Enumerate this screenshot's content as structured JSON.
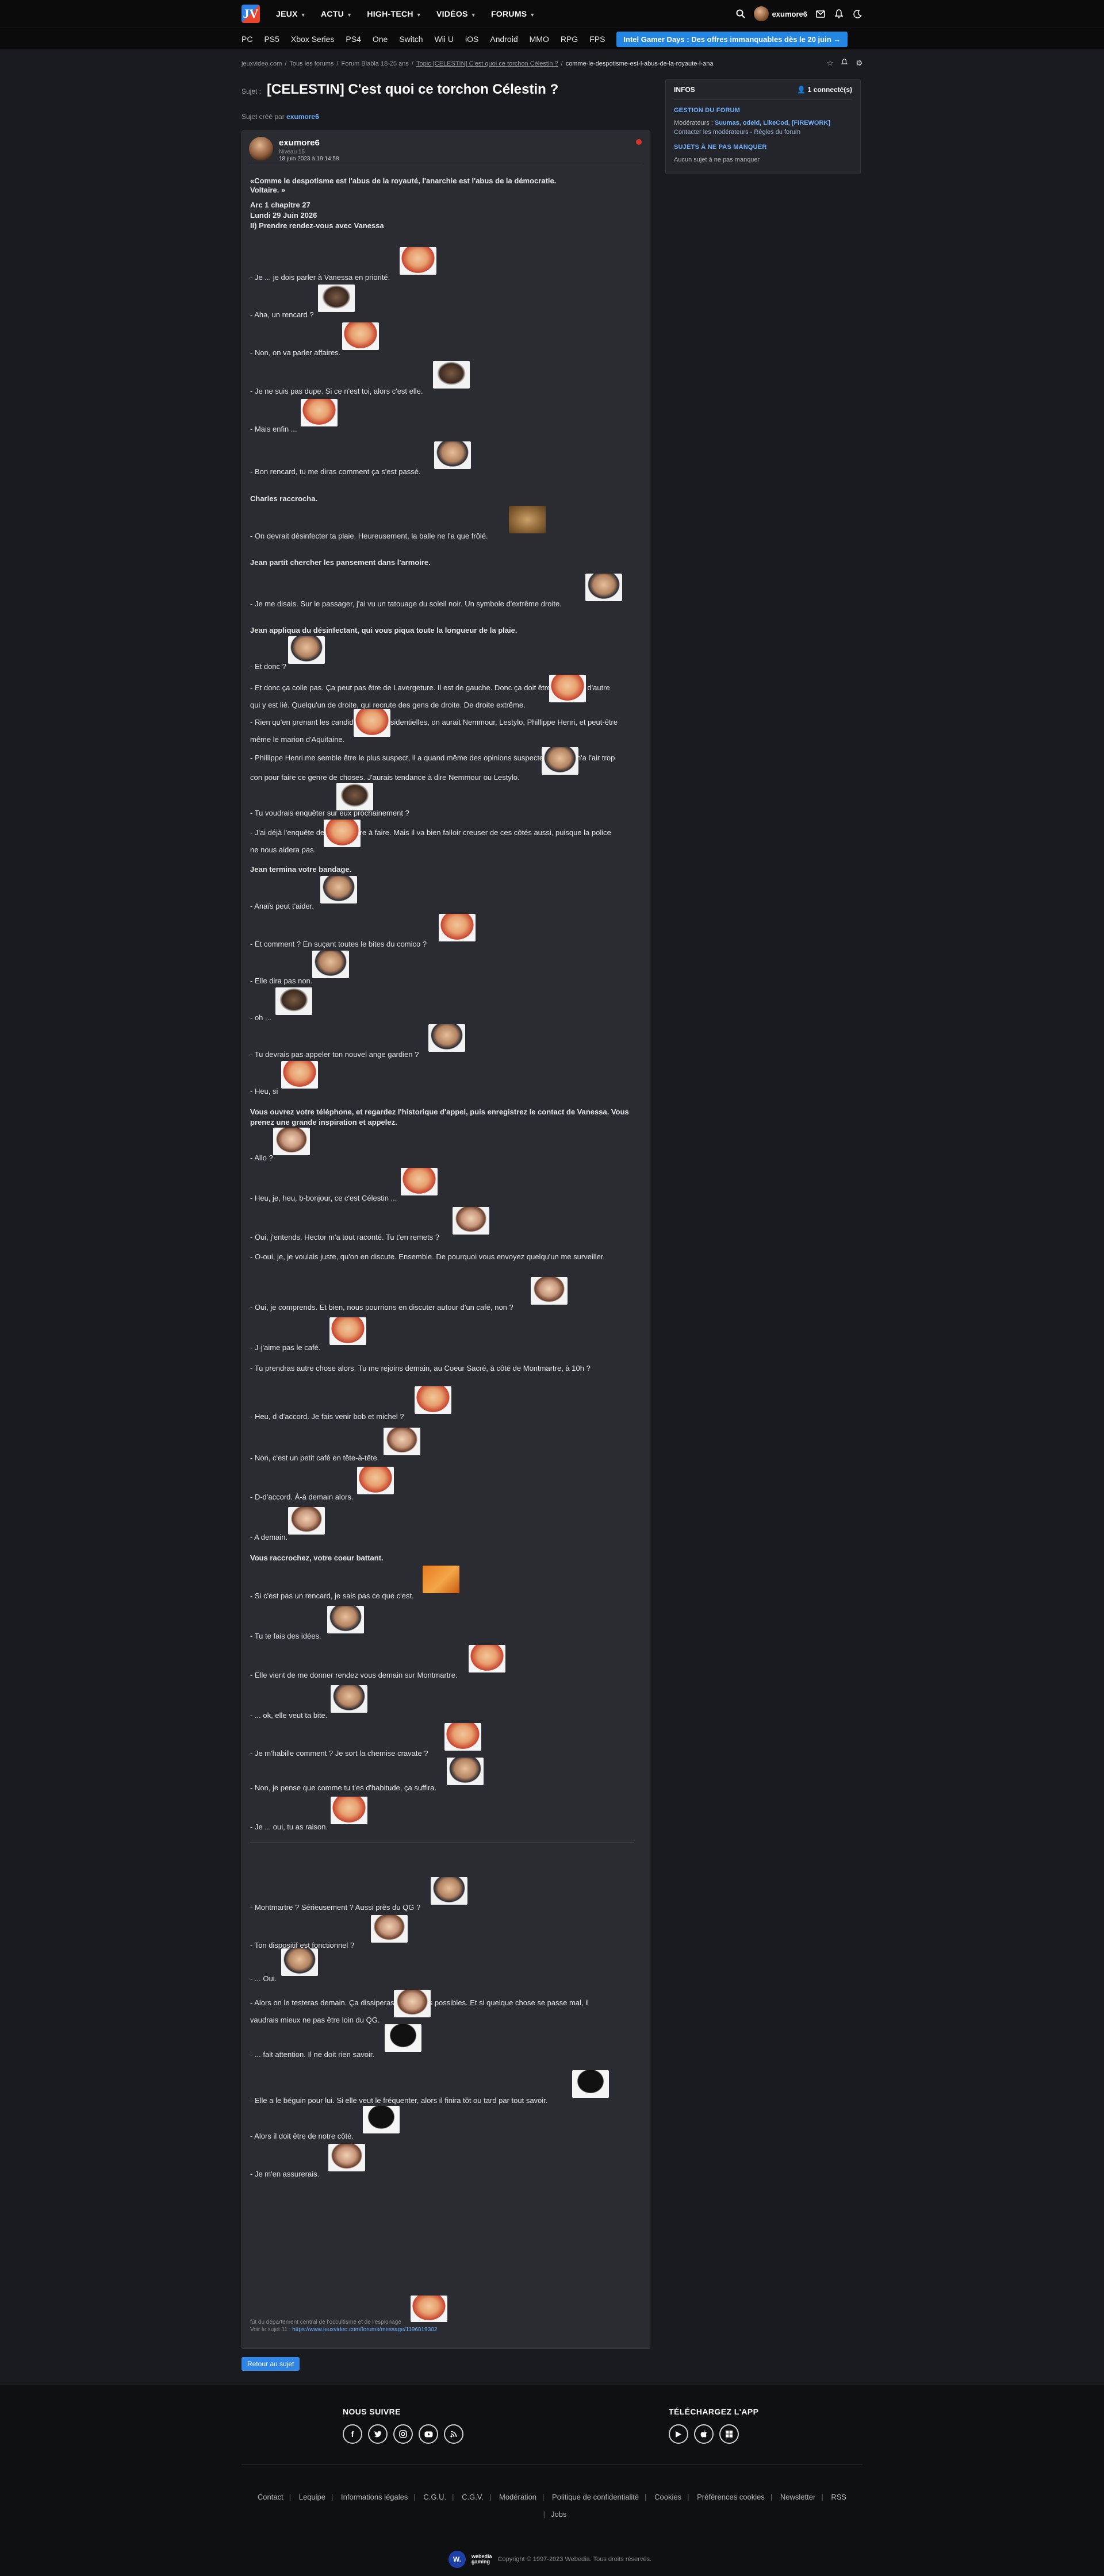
{
  "nav": {
    "logo": "JV",
    "main": [
      {
        "label": "JEUX"
      },
      {
        "label": "ACTU"
      },
      {
        "label": "HIGH-TECH"
      },
      {
        "label": "VIDÉOS"
      },
      {
        "label": "FORUMS"
      }
    ],
    "username": "exumore6",
    "platforms": [
      "PC",
      "PS5",
      "Xbox Series",
      "PS4",
      "One",
      "Switch",
      "Wii U",
      "iOS",
      "Android",
      "MMO",
      "RPG",
      "FPS"
    ],
    "promo": "Intel Gamer Days : Des offres immanquables dès le 20 juin →"
  },
  "breadcrumb": {
    "items": [
      "jeuxvideo.com",
      "Tous les forums",
      "Forum Blabla 18-25 ans"
    ],
    "topic_link": "Topic [CELESTIN] C'est quoi ce torchon Célestin ?",
    "current": "comme-le-despotisme-est-l-abus-de-la-royaute-l-ana"
  },
  "subject": {
    "label": "Sujet :",
    "title": "[CELESTIN] C'est quoi ce torchon Célestin ?",
    "created_by_label": "Sujet créé par",
    "created_by": "exumore6"
  },
  "sidebar": {
    "title": "INFOS",
    "connected": "1 connecté(s)",
    "sec1": "GESTION DU FORUM",
    "moderators_label": "Modérateurs :",
    "moderators": "Suumas, odeid, LikeCod, [FIREWORK]",
    "contact": "Contacter les modérateurs - Règles du forum",
    "sec2": "SUJETS À NE PAS MANQUER",
    "none": "Aucun sujet à ne pas manquer"
  },
  "post": {
    "author": "exumore6",
    "level": "Niveau 15",
    "date": "18 juin 2023 à 19:14:58",
    "lines": [
      {
        "t": "«Comme le despotisme est l'abus de la royauté, l'anarchie est l'abus de la démocratie.",
        "b": true
      },
      {
        "t": "Voltaire. »",
        "b": true
      },
      {
        "t": "Arc 1 chapitre 27",
        "b": true
      },
      {
        "t": "Lundi 29 Juin 2026",
        "b": true
      },
      {
        "t": "II) Prendre rendez-vous avec Vanessa",
        "b": true
      },
      {
        "t": "- Je ... je dois parler à Vanessa en priorité."
      },
      {
        "t": "- Aha, un rencard ?"
      },
      {
        "t": "- Non, on va parler affaires."
      },
      {
        "t": "- Je ne suis pas dupe. Si ce n'est toi, alors c'est elle."
      },
      {
        "t": "- Mais enfin ..."
      },
      {
        "t": "- Bon rencard, tu me diras comment ça s'est passé."
      },
      {
        "t": "Charles raccrocha.",
        "b": true
      },
      {
        "t": "- On devrait désinfecter ta plaie. Heureusement, la balle ne l'a que frôlé."
      },
      {
        "t": "Jean partit chercher les pansement dans l'armoire.",
        "b": true
      },
      {
        "t": "- Je me disais. Sur le passager, j'ai vu un tatouage du soleil noir. Un symbole d'extrême droite."
      },
      {
        "t": "Jean appliqua du désinfectant, qui vous piqua toute la longueur de la plaie.",
        "b": true
      },
      {
        "t": "- Et donc ?"
      },
      {
        "t": "- Et donc ça colle pas. Ça peut pas être de Lavergeture. Il est de gauche. Donc ça doit être quelqu'un d'autre"
      },
      {
        "t": "qui y est lié. Quelqu'un de droite, qui recrute des gens de droite. De droite extrême."
      },
      {
        "t": "- Rien qu'en prenant les candidats aux présidentielles, on aurait Nemmour, Lestylo, Phillippe Henri, et peut-être"
      },
      {
        "t": "même le marion d'Aquitaine."
      },
      {
        "t": "- Phillippe Henri me semble être le plus suspect, il a quand même des opinions suspectes. Mais il m'a l'air trop"
      },
      {
        "t": "con pour faire ce genre de choses. J'aurais tendance à dire Nemmour ou Lestylo."
      },
      {
        "t": "- Tu voudrais enquêter sur eux prochainement ?"
      },
      {
        "t": "- J'ai déjà l'enquête de Lavergeture à faire. Mais il va bien falloir creuser de ces côtés aussi, puisque la police"
      },
      {
        "t": "ne nous aidera pas."
      },
      {
        "t": "Jean termina votre bandage.",
        "b": true
      },
      {
        "t": "- Anaïs peut t'aider."
      },
      {
        "t": "- Et comment ? En suçant toutes le bites du comico ?"
      },
      {
        "t": "- Elle dira pas non."
      },
      {
        "t": "- oh ..."
      },
      {
        "t": "- Tu devrais pas appeler ton nouvel ange gardien ?"
      },
      {
        "t": "- Heu, si"
      },
      {
        "t": "Vous ouvrez votre téléphone, et regardez l'historique d'appel, puis enregistrez le contact de Vanessa. Vous",
        "b": true
      },
      {
        "t": "prenez une grande inspiration et appelez.",
        "b": true
      },
      {
        "t": "- Allo ?"
      },
      {
        "t": "- Heu, je, heu, b-bonjour, ce c'est Célestin ..."
      },
      {
        "t": "- Oui, j'entends. Hector m'a tout raconté. Tu t'en remets ?"
      },
      {
        "t": "- O-oui, je, je voulais juste, qu'on en discute. Ensemble. De pourquoi vous envoyez quelqu'un me surveiller."
      },
      {
        "t": "- Oui, je comprends. Et bien, nous pourrions en discuter autour d'un café, non ?"
      },
      {
        "t": "- J-j'aime pas le café."
      },
      {
        "t": "- Tu prendras autre chose alors. Tu me rejoins demain, au Coeur Sacré, à côté de Montmartre, à 10h ?"
      },
      {
        "t": "- Heu, d-d'accord. Je fais venir bob et michel ?"
      },
      {
        "t": "- Non, c'est un petit café en tête-à-tête."
      },
      {
        "t": "- D-d'accord. À-à demain alors."
      },
      {
        "t": "- A demain."
      },
      {
        "t": "Vous raccrochez, votre coeur battant.",
        "b": true
      },
      {
        "t": "- Si c'est pas un rencard, je sais pas ce que c'est."
      },
      {
        "t": "- Tu te fais des idées."
      },
      {
        "t": "- Elle vient de me donner rendez vous demain sur Montmartre."
      },
      {
        "t": "- ... ok, elle veut ta bite."
      },
      {
        "t": "- Je m'habille comment ? Je sort la chemise cravate ?"
      },
      {
        "t": "- Non, je pense que comme tu t'es d'habitude, ça suffira."
      },
      {
        "t": "- Je ... oui, tu as raison."
      },
      {
        "t": "- Montmartre ? Sérieusement ? Aussi près du QG ?"
      },
      {
        "t": "- Ton dispositif est fonctionnel ?"
      },
      {
        "t": "- ... Oui."
      },
      {
        "t": "- Alors on le testeras demain. Ça dissiperas ses doutes possibles. Et si quelque chose se passe mal, il"
      },
      {
        "t": "vaudrais mieux ne pas être loin du QG."
      },
      {
        "t": "- ... fait attention. Il ne doit rien savoir."
      },
      {
        "t": "- Elle a le béguin pour lui. Si elle veut le fréquenter, alors il finira tôt ou tard par tout savoir."
      },
      {
        "t": "- Alors il doit être de notre côté."
      },
      {
        "t": "- Je m'en assurerais."
      }
    ],
    "signature_l1": "fût du département central de l'occultisme et de l'espionage",
    "signature_l2_label": "Voir le sujet 11 :",
    "signature_link": "https://www.jeuxvideo.com/forums/message/1196019302"
  },
  "back_button": "Retour au sujet",
  "footer": {
    "follow": "NOUS SUIVRE",
    "app": "TÉLÉCHARGEZ L'APP",
    "social": [
      "facebook-icon",
      "twitter-icon",
      "instagram-icon",
      "youtube-icon",
      "rss-icon"
    ],
    "apps": [
      "android-icon",
      "apple-icon",
      "windows-icon"
    ],
    "links": [
      "Contact",
      "Lequipe",
      "Informations légales",
      "C.G.U.",
      "C.G.V.",
      "Modération",
      "Politique de confidentialité",
      "Cookies",
      "Préférences cookies",
      "Newsletter",
      "RSS",
      "Jobs"
    ],
    "logo_l1": "webedia",
    "logo_l2": "gaming",
    "copyright": "Copyright © 1997-2023 Webedia. Tous droits réservés."
  }
}
